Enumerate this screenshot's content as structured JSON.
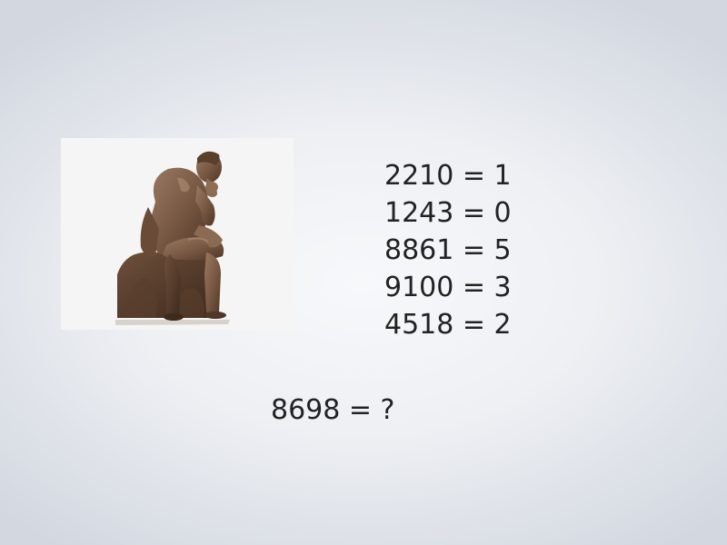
{
  "image": {
    "subject": "thinker-statue"
  },
  "equations": [
    {
      "text": "2210 = 1"
    },
    {
      "text": "1243 = 0"
    },
    {
      "text": "8861 = 5"
    },
    {
      "text": "9100 = 3"
    },
    {
      "text": "4518 = 2"
    }
  ],
  "question": {
    "text": "8698 = ?"
  },
  "colors": {
    "text": "#222222",
    "statue": "#7a5a44",
    "background": "#eef0f4"
  }
}
